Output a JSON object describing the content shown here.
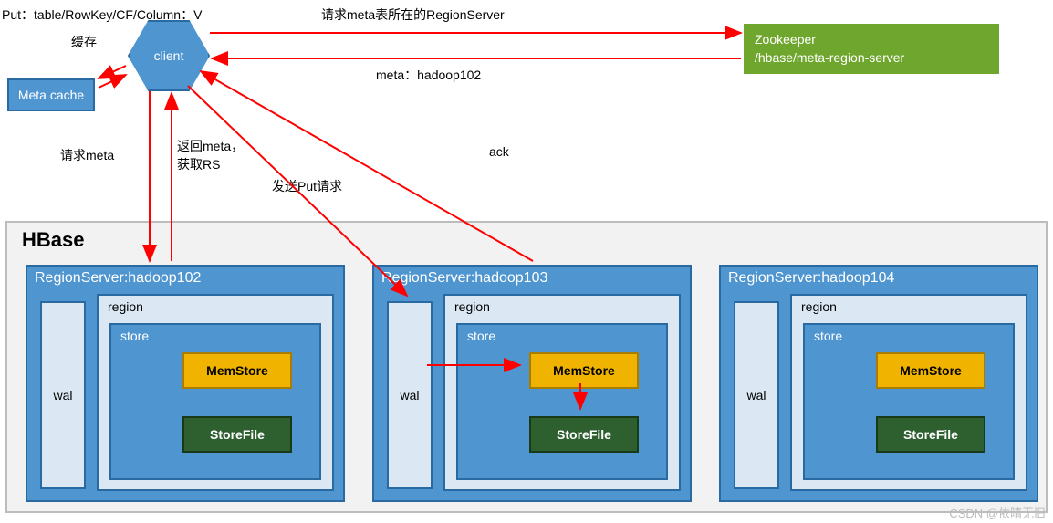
{
  "topText": "Put：table/RowKey/CF/Column：V",
  "client": {
    "label": "client"
  },
  "metaCache": {
    "label": "Meta cache"
  },
  "cacheLabel": "缓存",
  "zookeeper": {
    "line1": "Zookeeper",
    "line2": "/hbase/meta-region-server"
  },
  "arrows": {
    "reqMetaRS": "请求meta表所在的RegionServer",
    "metaReturn": "meta：hadoop102",
    "reqMeta": "请求meta",
    "returnMeta": "返回meta，\n获取RS",
    "ack": "ack",
    "sendPut": "发送Put请求"
  },
  "hbase": {
    "title": "HBase",
    "servers": [
      {
        "name": "RegionServer:hadoop102",
        "region": "region",
        "wal": "wal",
        "store": "store",
        "mem": "MemStore",
        "sf": "StoreFile"
      },
      {
        "name": "RegionServer:hadoop103",
        "region": "region",
        "wal": "wal",
        "store": "store",
        "mem": "MemStore",
        "sf": "StoreFile"
      },
      {
        "name": "RegionServer:hadoop104",
        "region": "region",
        "wal": "wal",
        "store": "store",
        "mem": "MemStore",
        "sf": "StoreFile"
      }
    ]
  },
  "watermark": "CSDN @依晴无旧",
  "chart_data": {
    "type": "diagram",
    "title": "HBase Put flow",
    "nodes": [
      {
        "id": "client",
        "label": "client"
      },
      {
        "id": "metaCache",
        "label": "Meta cache"
      },
      {
        "id": "zookeeper",
        "label": "Zookeeper /hbase/meta-region-server"
      },
      {
        "id": "rs102",
        "label": "RegionServer:hadoop102",
        "children": [
          "wal",
          "region>store>MemStore,StoreFile"
        ]
      },
      {
        "id": "rs103",
        "label": "RegionServer:hadoop103",
        "children": [
          "wal",
          "region>store>MemStore,StoreFile"
        ]
      },
      {
        "id": "rs104",
        "label": "RegionServer:hadoop104",
        "children": [
          "wal",
          "region>store>MemStore,StoreFile"
        ]
      }
    ],
    "edges": [
      {
        "from": "client",
        "to": "zookeeper",
        "label": "请求meta表所在的RegionServer"
      },
      {
        "from": "zookeeper",
        "to": "client",
        "label": "meta：hadoop102"
      },
      {
        "from": "client",
        "to": "metaCache",
        "label": "缓存"
      },
      {
        "from": "client",
        "to": "rs102",
        "label": "请求meta"
      },
      {
        "from": "rs102",
        "to": "client",
        "label": "返回meta，获取RS"
      },
      {
        "from": "client",
        "to": "rs103",
        "label": "发送Put请求"
      },
      {
        "from": "rs103",
        "to": "client",
        "label": "ack"
      },
      {
        "from": "rs103.wal",
        "to": "rs103.MemStore"
      },
      {
        "from": "rs103.MemStore",
        "to": "rs103.StoreFile"
      }
    ]
  }
}
